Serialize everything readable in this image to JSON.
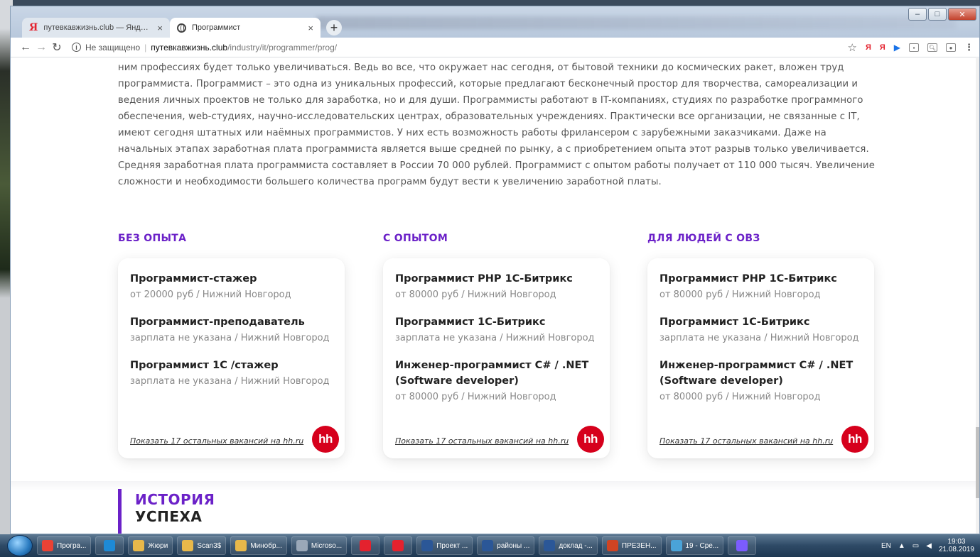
{
  "browser": {
    "tabs": [
      {
        "title": "путевкавжизнь.club — Яндекс: ",
        "favicon": "yandex-icon"
      },
      {
        "title": "Программист",
        "favicon": "globe-icon"
      }
    ],
    "new_tab_label": "+",
    "address": {
      "security_label": "Не защищено",
      "host": "путевкавжизнь.club",
      "path": "/industry/it/programmer/prog/"
    },
    "window_controls": [
      "–",
      "□",
      "✕"
    ]
  },
  "content": {
    "paragraph": "ним профессиях будет только увеличиваться. Ведь во все, что окружает нас сегодня, от бытовой техники до космических ракет, вложен труд программиста. Программист – это одна из уникальных профессий, которые предлагают бесконечный простор для творчества, самореализации и ведения личных проектов не только для заработка, но и для души. Программисты работают в IT-компаниях, студиях по разработке программного обеспечения, web-студиях, научно-исследовательских центрах, образовательных учреждениях. Практически все организации, не связанные с  IT, имеют сегодня штатных или наёмных программистов. У них есть возможность работы фрилансером с зарубежными заказчиками. Даже на начальных этапах заработная плата программиста является выше средней по рынку, а с приобретением опыта этот разрыв только увеличивается. Средняя заработная плата программиста составляет в России 70 000 рублей. Программист с опытом работы получает от 110 000 тысяч. Увеличение сложности и необходимости большего количества программ будут вести к увеличению заработной платы.",
    "columns": [
      {
        "title": "БЕЗ ОПЫТА",
        "jobs": [
          {
            "title": "Программист-стажер",
            "meta": "от 20000 руб / Нижний Новгород"
          },
          {
            "title": "Программист-преподаватель",
            "meta": "зарплата не указана / Нижний Новгород"
          },
          {
            "title": "Программист 1С /стажер",
            "meta": "зарплата не указана / Нижний Новгород"
          }
        ],
        "link": "Показать 17 остальных вакансий на hh.ru"
      },
      {
        "title": "С ОПЫТОМ",
        "jobs": [
          {
            "title": "Программист PHP 1С-Битрикс",
            "meta": "от 80000 руб / Нижний Новгород"
          },
          {
            "title": "Программист 1С-Битрикс",
            "meta": "зарплата не указана / Нижний Новгород"
          },
          {
            "title": "Инженер-программист C# / .NET (Software developer)",
            "meta": "от 80000 руб / Нижний Новгород"
          }
        ],
        "link": "Показать 17 остальных вакансий на hh.ru"
      },
      {
        "title": "ДЛЯ ЛЮДЕЙ С ОВЗ",
        "jobs": [
          {
            "title": "Программист PHP 1С-Битрикс",
            "meta": "от 80000 руб / Нижний Новгород"
          },
          {
            "title": "Программист 1С-Битрикс",
            "meta": "зарплата не указана / Нижний Новгород"
          },
          {
            "title": "Инженер-программист C# / .NET (Software developer)",
            "meta": "от 80000 руб / Нижний Новгород"
          }
        ],
        "link": "Показать 17 остальных вакансий на hh.ru"
      }
    ],
    "hh_badge": "hh",
    "history_line1": "ИСТОРИЯ",
    "history_line2": "УСПЕХА"
  },
  "taskbar": {
    "items": [
      {
        "label": "Програ...",
        "icon": "chrome-icon",
        "color": "#e94235"
      },
      {
        "label": "",
        "icon": "skype-icon",
        "color": "#1e8ad6"
      },
      {
        "label": "Жюри",
        "icon": "folder-icon",
        "color": "#e8b84a"
      },
      {
        "label": "Scan3$",
        "icon": "folder-icon",
        "color": "#e8b84a"
      },
      {
        "label": "Минобр...",
        "icon": "folder-icon",
        "color": "#e8b84a"
      },
      {
        "label": "Microso...",
        "icon": "mail-icon",
        "color": "#9aa8b8"
      },
      {
        "label": "",
        "icon": "yandex-icon",
        "color": "#e4222e"
      },
      {
        "label": "",
        "icon": "yandex-browser-icon",
        "color": "#e4222e"
      },
      {
        "label": "Проект ...",
        "icon": "word-icon",
        "color": "#2b5797"
      },
      {
        "label": "районы ...",
        "icon": "word-icon",
        "color": "#2b5797"
      },
      {
        "label": "доклад -...",
        "icon": "word-icon",
        "color": "#2b5797"
      },
      {
        "label": "ПРЕЗЕН...",
        "icon": "powerpoint-icon",
        "color": "#d04423"
      },
      {
        "label": "19 - Сре...",
        "icon": "image-viewer-icon",
        "color": "#4aa3d8"
      },
      {
        "label": "",
        "icon": "alice-icon",
        "color": "#7b5cff"
      }
    ],
    "lang": "EN",
    "time": "19:03",
    "date": "21.08.2019"
  },
  "colors": {
    "accent": "#6b21c8",
    "hh_red": "#d6001c"
  }
}
